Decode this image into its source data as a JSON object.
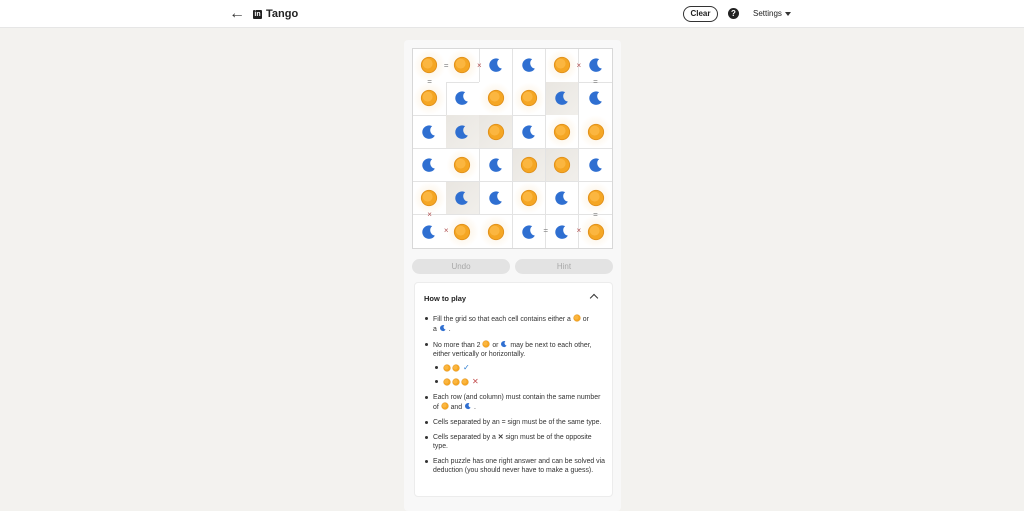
{
  "header": {
    "back_icon": "arrow-left-icon",
    "logo_text": "in",
    "title": "Tango",
    "clear_label": "Clear",
    "help_label": "?",
    "settings_label": "Settings"
  },
  "colors": {
    "sun": "#f5a623",
    "moon": "#2f6fd1",
    "constraint_x": "#b05050"
  },
  "board": {
    "rows": [
      [
        "sun",
        "sun",
        "moon",
        "moon",
        "sun",
        "moon"
      ],
      [
        "sun",
        "moon",
        "sun",
        "sun",
        "moon",
        "moon"
      ],
      [
        "moon",
        "moon",
        "sun",
        "moon",
        "sun",
        "sun"
      ],
      [
        "moon",
        "sun",
        "moon",
        "sun",
        "sun",
        "moon"
      ],
      [
        "sun",
        "moon",
        "moon",
        "sun",
        "moon",
        "sun"
      ],
      [
        "moon",
        "sun",
        "sun",
        "moon",
        "moon",
        "sun"
      ]
    ],
    "shaded": [
      [
        1,
        4
      ],
      [
        2,
        1
      ],
      [
        2,
        2
      ],
      [
        3,
        3
      ],
      [
        3,
        4
      ],
      [
        4,
        1
      ]
    ],
    "constraints_h": [
      {
        "row": 0,
        "col": 0,
        "sym": "="
      },
      {
        "row": 0,
        "col": 1,
        "sym": "×"
      },
      {
        "row": 0,
        "col": 4,
        "sym": "×"
      },
      {
        "row": 5,
        "col": 0,
        "sym": "×"
      },
      {
        "row": 5,
        "col": 3,
        "sym": "="
      },
      {
        "row": 5,
        "col": 4,
        "sym": "×"
      }
    ],
    "constraints_v": [
      {
        "row": 0,
        "col": 0,
        "sym": "="
      },
      {
        "row": 0,
        "col": 5,
        "sym": "="
      },
      {
        "row": 4,
        "col": 0,
        "sym": "×"
      },
      {
        "row": 4,
        "col": 5,
        "sym": "="
      }
    ]
  },
  "controls": {
    "undo_label": "Undo",
    "hint_label": "Hint"
  },
  "howto": {
    "title": "How to play",
    "r1a": "Fill the grid so that each cell contains either a",
    "r1b": "or",
    "r1c": "a",
    "r1d": ".",
    "r2a": "No more than 2",
    "r2b": "or",
    "r2c": "may be next to each other, either vertically or horizontally.",
    "ok_mark": "✓",
    "bad_mark": "✕",
    "r3a": "Each row (and column) must contain the same number of",
    "r3b": "and",
    "r3c": ".",
    "r4": "Cells separated by an = sign must be of the same type.",
    "r5a": "Cells separated by a",
    "r5b": "✕",
    "r5c": "sign must be of the opposite type.",
    "r6": "Each puzzle has one right answer and can be solved via deduction (you should never have to make a guess)."
  }
}
